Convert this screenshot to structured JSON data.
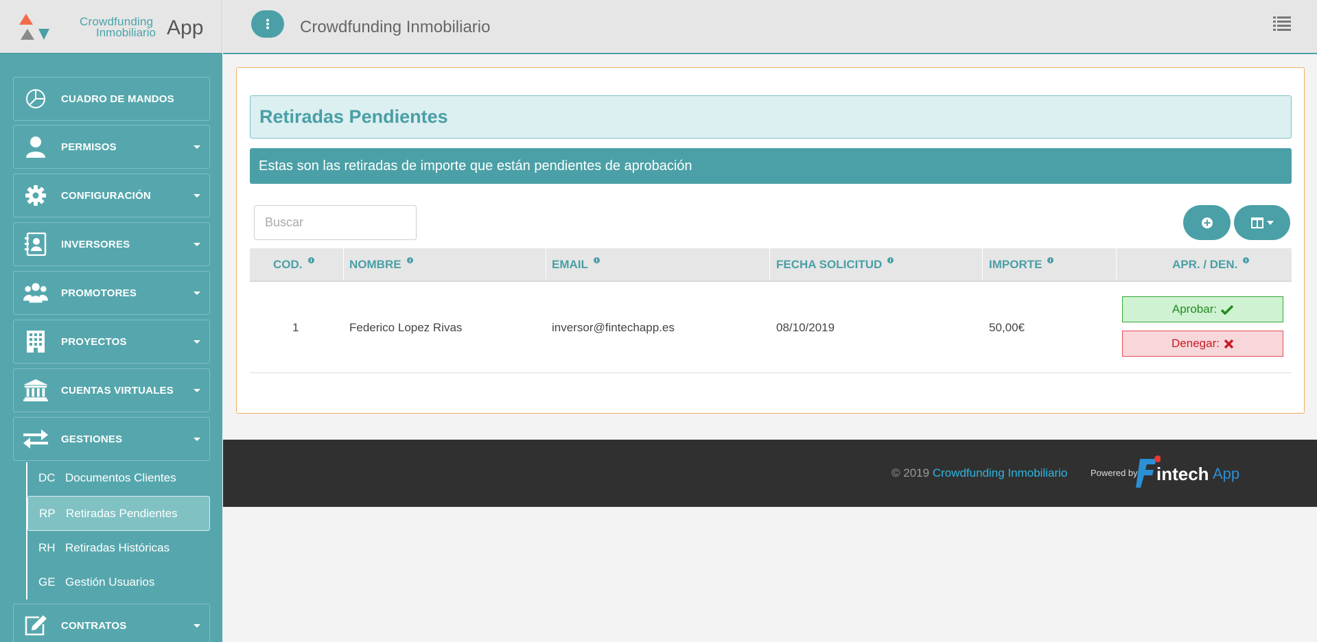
{
  "brand": {
    "line1": "Crowdfunding",
    "line2": "Inmobiliario",
    "app": "App"
  },
  "sidebar": {
    "items": [
      {
        "label": "CUADRO DE MANDOS",
        "icon": "dashboard-pie-icon"
      },
      {
        "label": "PERMISOS",
        "icon": "user-icon"
      },
      {
        "label": "CONFIGURACIÓN",
        "icon": "gear-icon"
      },
      {
        "label": "INVERSORES",
        "icon": "contact-card-icon"
      },
      {
        "label": "PROMOTORES",
        "icon": "users-group-icon"
      },
      {
        "label": "PROYECTOS",
        "icon": "building-icon"
      },
      {
        "label": "CUENTAS VIRTUALES",
        "icon": "bank-icon"
      },
      {
        "label": "GESTIONES",
        "icon": "exchange-arrows-icon"
      },
      {
        "label": "CONTRATOS",
        "icon": "edit-icon"
      }
    ],
    "submenu": [
      {
        "abbr": "DC",
        "label": "Documentos Clientes"
      },
      {
        "abbr": "RP",
        "label": "Retiradas Pendientes",
        "active": true
      },
      {
        "abbr": "RH",
        "label": "Retiradas Históricas"
      },
      {
        "abbr": "GE",
        "label": "Gestión Usuarios"
      }
    ]
  },
  "topbar": {
    "title": "Crowdfunding Inmobiliario"
  },
  "main": {
    "heading": "Retiradas Pendientes",
    "subtitle": "Estas son las retiradas de importe que están pendientes de aprobación",
    "search": {
      "placeholder": "Buscar",
      "value": ""
    },
    "table": {
      "columns": [
        "COD.",
        "NOMBRE",
        "EMAIL",
        "FECHA SOLICITUD",
        "IMPORTE",
        "APR. / DEN."
      ],
      "rows": [
        {
          "cod": "1",
          "nombre": "Federico Lopez Rivas",
          "email": "inversor@fintechapp.es",
          "fecha": "08/10/2019",
          "importe": "50,00€",
          "approve": "Aprobar:",
          "deny": "Denegar:"
        }
      ]
    }
  },
  "footer": {
    "copyright": "© 2019",
    "brand": "Crowdfunding Inmobiliario",
    "powered_by": "Powered by",
    "logo_text": "intech",
    "logo_app": "App"
  },
  "colors": {
    "teal": "#4aa0a6",
    "sidebar": "#56a7ad",
    "orange_border": "#f0ad60",
    "approve": "#228b22",
    "deny": "#c81b25"
  }
}
